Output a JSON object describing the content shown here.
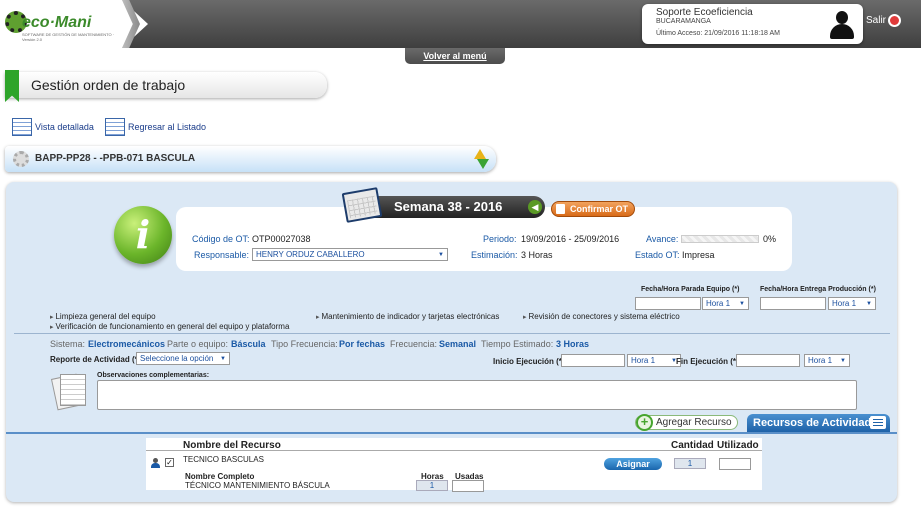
{
  "header": {
    "logo_text": "eco·Mani",
    "logo_sub": "SOFTWARE DE GESTIÓN DE MANTENIMIENTO · Versión 2.0",
    "user_name": "Soporte Ecoeficiencia",
    "user_city": "BUCARAMANGA",
    "last_access": "Último Acceso: 21/09/2016 11:18:18 AM",
    "logout_label": "Salir",
    "back_menu": "Volver al menú"
  },
  "page": {
    "title": "Gestión orden de trabajo",
    "detail_view": "Vista detallada",
    "back_to_list": "Regresar al Listado",
    "equipment": "BAPP-PP28 - -PPB-071 BASCULA"
  },
  "week": {
    "label": "Semana 38 - 2016",
    "prev_icon": "arrow-left-icon",
    "confirm_label": "Confirmar OT"
  },
  "ot": {
    "code_label": "Código de OT:",
    "code_value": "OTP00027038",
    "period_label": "Periodo:",
    "period_value": "19/09/2016 - 25/09/2016",
    "progress_label": "Avance:",
    "progress_value": "0%",
    "progress": 0,
    "responsible_label": "Responsable:",
    "responsible_value": "HENRY ORDUZ CABALLERO",
    "estimate_label": "Estimación:",
    "estimate_value": "3 Horas",
    "state_label": "Estado OT:",
    "state_value": "Impresa"
  },
  "schedule": {
    "stop_label": "Fecha/Hora Parada Equipo (*)",
    "delivery_label": "Fecha/Hora Entrega Producción (*)",
    "hour_option": "Hora 1"
  },
  "activities": [
    "Limpieza general del equipo",
    "Mantenimiento de indicador y tarjetas electrónicas",
    "Revisión de conectores y sistema eléctrico",
    "Verificación de funcionamiento en general del equipo y plataforma"
  ],
  "meta": {
    "system_label": "Sistema:",
    "system_value": "Electromecánicos",
    "part_label": "Parte o equipo:",
    "part_value": "Báscula",
    "freq_type_label": "Tipo Frecuencia:",
    "freq_type_value": "Por fechas",
    "freq_label": "Frecuencia:",
    "freq_value": "Semanal",
    "time_label": "Tiempo Estimado:",
    "time_value": "3 Horas"
  },
  "report": {
    "label": "Reporte de Actividad (*):",
    "select_value": "Seleccione la opción",
    "start_label": "Inicio Ejecución (*)",
    "end_label": "Fin Ejecución (*)",
    "hour_option": "Hora 1",
    "notes_label": "Observaciones complementarias:"
  },
  "resources": {
    "add_label": "Agregar Recurso",
    "tab_label": "Recursos de Actividad",
    "col_name": "Nombre del Recurso",
    "col_qty": "Cantidad",
    "col_used": "Utilizado",
    "row_name": "TECNICO BASCULAS",
    "assign_label": "Asignar",
    "qty_value": "1",
    "full_name_label": "Nombre Completo",
    "full_name_value": "TÉCNICO MANTENIMIENTO BÁSCULA",
    "hours_label": "Horas",
    "used_label": "Usadas",
    "hours_value": "1",
    "check_mark": "✓"
  },
  "colors": {
    "accent_green": "#2ea42a",
    "link_blue": "#1b5aa6",
    "panel_bg": "#dbe8f5",
    "confirm_orange": "#d86b19"
  }
}
